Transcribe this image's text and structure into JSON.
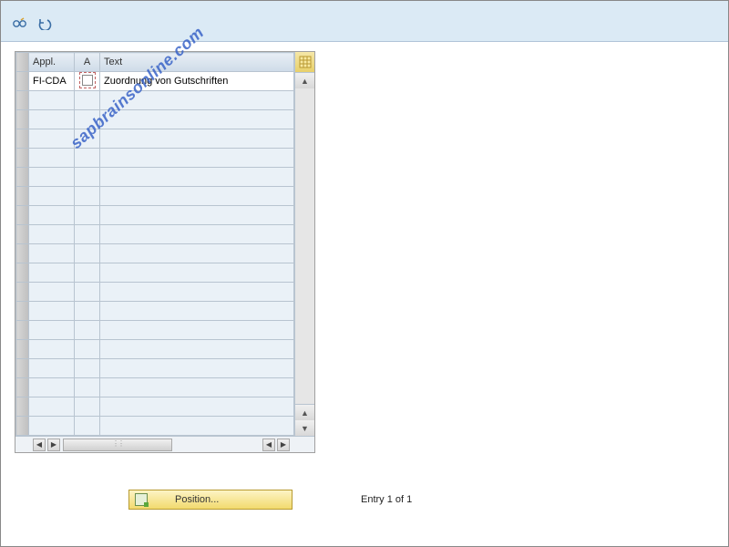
{
  "toolbar": {
    "glasses_icon": "display-detail",
    "undo_icon": "undo"
  },
  "grid": {
    "columns": {
      "appl": "Appl.",
      "a": "A",
      "text": "Text"
    },
    "rows": [
      {
        "appl": "FI-CDA",
        "a_checked": false,
        "text": "Zuordnung von Gutschriften"
      }
    ],
    "empty_row_count": 18
  },
  "footer": {
    "position_label": "Position...",
    "entry_text": "Entry 1 of 1"
  },
  "watermark": "sapbrainsonline.com"
}
